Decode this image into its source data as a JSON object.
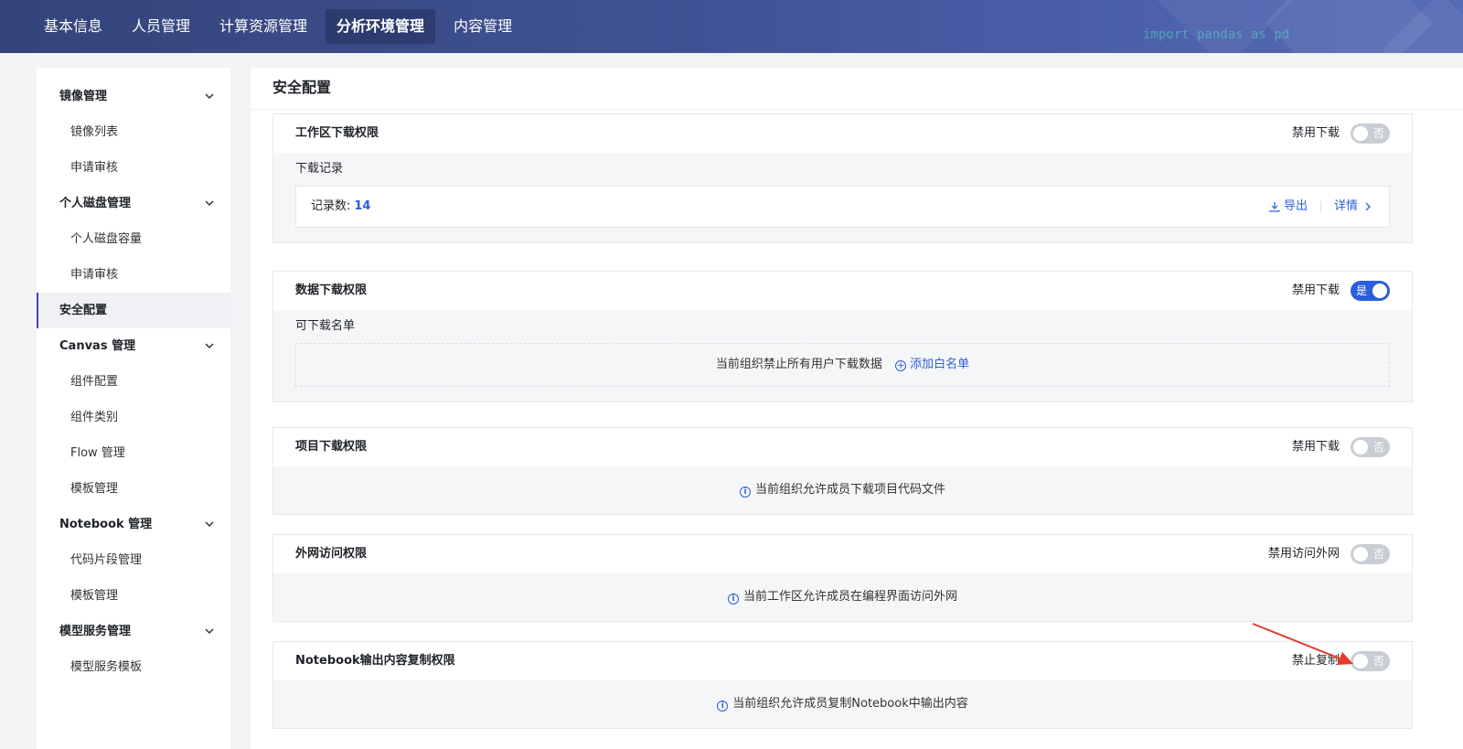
{
  "nav": {
    "tabs": [
      {
        "label": "基本信息"
      },
      {
        "label": "人员管理"
      },
      {
        "label": "计算资源管理"
      },
      {
        "label": "分析环境管理",
        "active": true
      },
      {
        "label": "内容管理"
      }
    ],
    "code_snippet": "import pandas as pd"
  },
  "sidebar": {
    "groups": [
      {
        "label": "镜像管理",
        "items": [
          "镜像列表",
          "申请审核"
        ]
      },
      {
        "label": "个人磁盘管理",
        "items": [
          "个人磁盘容量",
          "申请审核"
        ]
      },
      {
        "label": "安全配置"
      },
      {
        "label": "Canvas 管理",
        "items": [
          "组件配置",
          "组件类别",
          "Flow 管理",
          "模板管理"
        ]
      },
      {
        "label": "Notebook 管理",
        "items": [
          "代码片段管理",
          "模板管理"
        ]
      },
      {
        "label": "模型服务管理",
        "items": [
          "模型服务模板"
        ]
      }
    ]
  },
  "main": {
    "title": "安全配置",
    "workspace": {
      "title": "工作区下载权限",
      "toggle_label": "禁用下载",
      "toggle_text": "否",
      "sub_label": "下载记录",
      "record_label": "记录数:",
      "record_count": "14",
      "export_label": "导出",
      "detail_label": "详情"
    },
    "data": {
      "title": "数据下载权限",
      "toggle_label": "禁用下载",
      "toggle_text": "是",
      "sub_label": "可下载名单",
      "empty_text": "当前组织禁止所有用户下载数据",
      "add_label": "添加白名单"
    },
    "project": {
      "title": "项目下载权限",
      "toggle_label": "禁用下载",
      "toggle_text": "否",
      "info": "当前组织允许成员下载项目代码文件"
    },
    "network": {
      "title": "外网访问权限",
      "toggle_label": "禁用访问外网",
      "toggle_text": "否",
      "info": "当前工作区允许成员在编程界面访问外网"
    },
    "notebook": {
      "title": "Notebook输出内容复制权限",
      "toggle_label": "禁止复制",
      "toggle_text": "否",
      "info": "当前组织允许成员复制Notebook中输出内容"
    }
  },
  "colors": {
    "accent": "#2b5fd9",
    "annotation_arrow": "#e8392b",
    "nav_bg": "#3f5193"
  }
}
